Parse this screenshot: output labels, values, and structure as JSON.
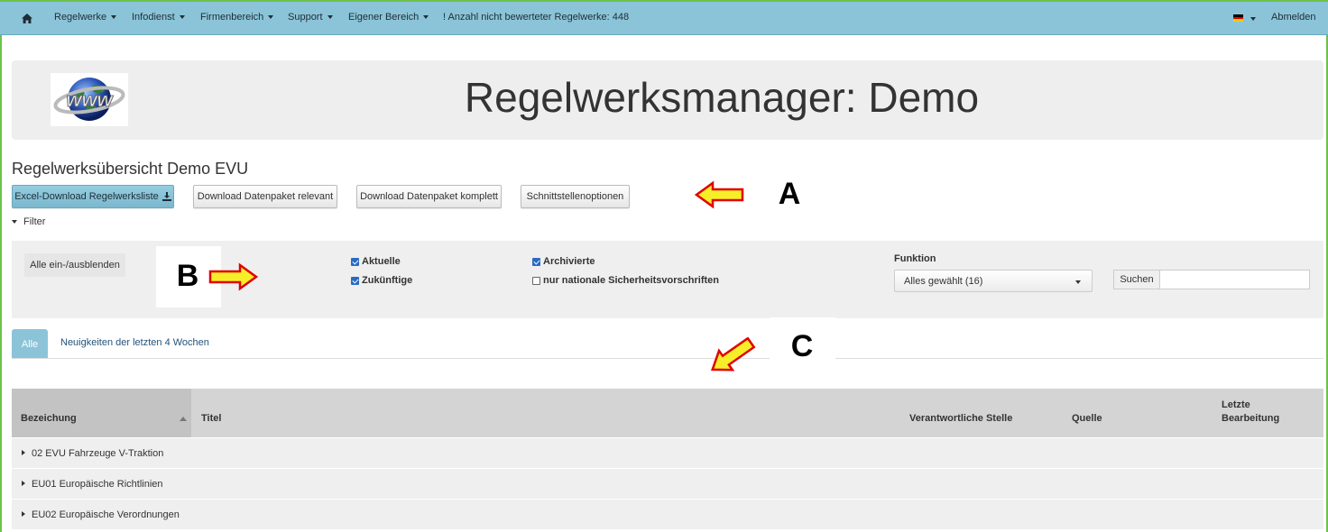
{
  "navbar": {
    "home_icon": "home-icon",
    "items": [
      {
        "label": "Regelwerke",
        "dropdown": true
      },
      {
        "label": "Infodienst",
        "dropdown": true
      },
      {
        "label": "Firmenbereich",
        "dropdown": true
      },
      {
        "label": "Support",
        "dropdown": true
      },
      {
        "label": "Eigener Bereich",
        "dropdown": true
      }
    ],
    "notice": "! Anzahl nicht bewerteter Regelwerke: 448",
    "language_flag": "german-flag-icon",
    "logout": "Abmelden",
    "bg_color": "#8bc4d8"
  },
  "jumbotron": {
    "title": "Regelwerksmanager: Demo",
    "logo": "www-globe-logo"
  },
  "overview": {
    "title": "Regelwerksübersicht Demo EVU",
    "buttons": {
      "excel": "Excel-Download Regelwerksliste",
      "download_relevant": "Download Datenpaket relevant",
      "download_complete": "Download Datenpaket komplett",
      "interface_options": "Schnittstellenoptionen"
    }
  },
  "filter": {
    "toggle_label": "Filter",
    "show_hide_all": "Alle ein-/ausblenden",
    "checkboxes": {
      "aktuelle": {
        "label": "Aktuelle",
        "checked": true
      },
      "zukuenftige": {
        "label": "Zukünftige",
        "checked": true
      },
      "archivierte": {
        "label": "Archivierte",
        "checked": true
      },
      "national": {
        "label": "nur nationale Sicherheitsvorschriften",
        "checked": false
      }
    },
    "funktion_label": "Funktion",
    "funktion_selected": "Alles gewählt (16)",
    "search_label": "Suchen",
    "search_value": ""
  },
  "tabs": {
    "all": "Alle",
    "news": "Neuigkeiten der letzten 4 Wochen"
  },
  "table": {
    "columns": {
      "bezeichnung": "Bezeichung",
      "titel": "Titel",
      "stelle": "Verantwortliche Stelle",
      "quelle": "Quelle",
      "letzte_1": "Letzte",
      "letzte_2": "Bearbeitung"
    },
    "rows": [
      "02 EVU Fahrzeuge V-Traktion",
      "EU01 Europäische Richtlinien",
      "EU02 Europäische Verordnungen"
    ]
  },
  "annotations": {
    "a": "A",
    "b": "B",
    "c": "C",
    "arrow_fill": "#f7ee2a",
    "arrow_stroke": "#e00000"
  }
}
